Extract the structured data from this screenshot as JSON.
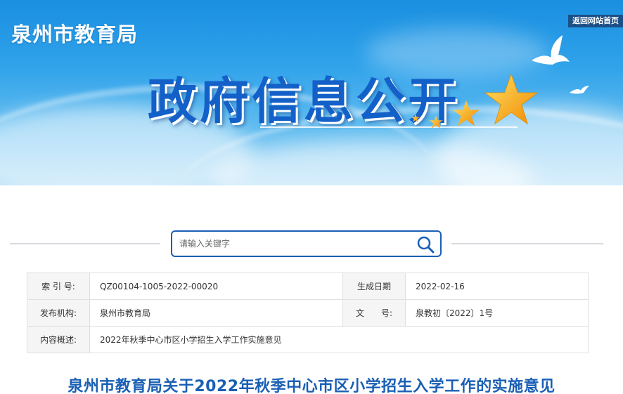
{
  "header": {
    "site_name": "泉州市教育局",
    "home_link": "返回网站首页",
    "banner_title": "政府信息公开"
  },
  "search": {
    "placeholder": "请输入关键字",
    "icon": "search-icon"
  },
  "info": {
    "index_label": "索 引 号:",
    "index_value": "QZ00104-1005-2022-00020",
    "date_label": "生成日期",
    "date_value": "2022-02-16",
    "publisher_label": "发布机构:",
    "publisher_value": "泉州市教育局",
    "doc_no_label": "文　　号:",
    "doc_no_value": "泉教初〔2022〕1号",
    "summary_label": "内容概述:",
    "summary_value": "2022年秋季中心市区小学招生入学工作实施意见"
  },
  "article": {
    "title": "泉州市教育局关于2022年秋季中心市区小学招生入学工作的实施意见"
  },
  "colors": {
    "accent": "#1a5fb4",
    "home_link_bg": "#1b4f86",
    "banner_title": "#1460c9",
    "star": "#f7b500"
  }
}
